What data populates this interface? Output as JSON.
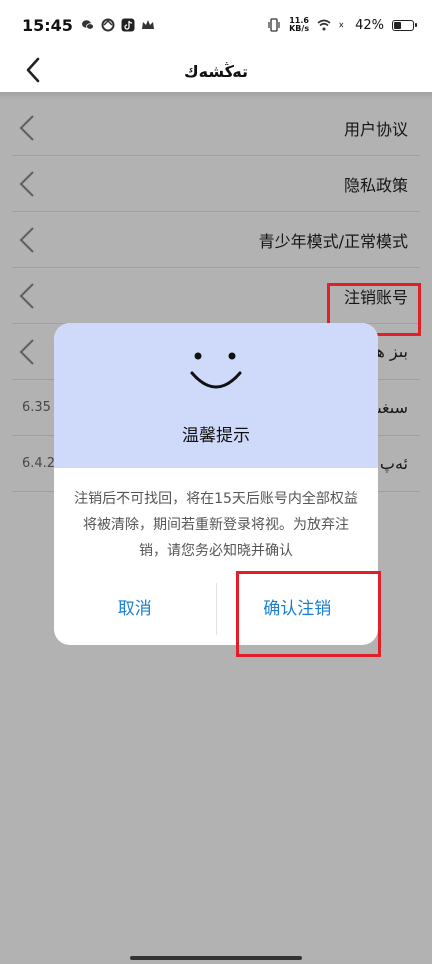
{
  "status_bar": {
    "time": "15:45",
    "net_speed_value": "11.6",
    "net_speed_unit": "KB/s",
    "battery_percent": "42%",
    "battery_level": 0.42,
    "left_icons": [
      "wechat-icon",
      "sync-icon",
      "tiktok-icon",
      "crown-icon"
    ],
    "right_icons": [
      "vibrate-icon",
      "wifi-icon",
      "sim-off-icon",
      "battery-icon"
    ]
  },
  "nav": {
    "title": "تەڭشەك"
  },
  "settings": {
    "items": [
      {
        "label": "用户协议"
      },
      {
        "label": "隐私政策"
      },
      {
        "label": "青少年模式/正常模式"
      },
      {
        "label": "注销账号"
      },
      {
        "label": "بىز ھەققىدە"
      },
      {
        "label": "سىغىم",
        "version": "6.35"
      },
      {
        "label": "ئەپ نەشرى",
        "version": "6.4.2"
      }
    ]
  },
  "dialog": {
    "title": "温馨提示",
    "message": "注销后不可找回，将在15天后账号内全部权益将被清除，期间若重新登录将视。为放弃注销，请您务必知晓并确认",
    "cancel_label": "取消",
    "confirm_label": "确认注销"
  },
  "colors": {
    "dialog_header": "#cfd9f9",
    "button_text": "#1c7fd0",
    "highlight": "#e21f26",
    "overlay": "rgba(0,0,0,0.30)"
  }
}
